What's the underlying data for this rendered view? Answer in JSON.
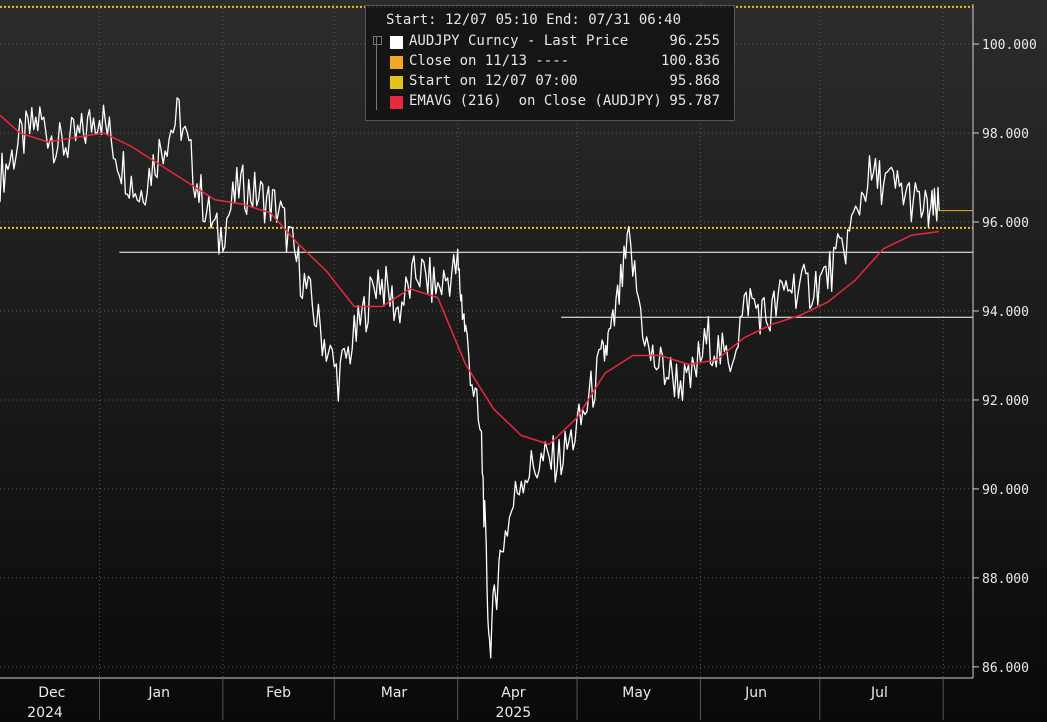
{
  "legend": {
    "header": "Start: 12/07 05:10 End: 07/31 06:40",
    "items": [
      {
        "label": "AUDJPY Curncy - Last Price",
        "value": "96.255",
        "color": "#ffffff"
      },
      {
        "label": "Close on 11/13 ----",
        "value": "100.836",
        "color": "#f5a623"
      },
      {
        "label": "Start on 12/07 07:00",
        "value": "95.868",
        "color": "#e3c21b"
      },
      {
        "label": "EMAVG (216)  on Close (AUDJPY)",
        "value": "95.787",
        "color": "#e8283c"
      }
    ]
  },
  "chart_data": {
    "type": "line",
    "y_axis_position": "right",
    "ylim": [
      85.75,
      100.9
    ],
    "yticks": [
      86.0,
      88.0,
      90.0,
      92.0,
      94.0,
      96.0,
      98.0,
      100.0
    ],
    "ytick_labels": [
      "86.000",
      "88.000",
      "90.000",
      "92.000",
      "94.000",
      "96.000",
      "98.000",
      "100.000"
    ],
    "x_months": [
      {
        "label": "Dec",
        "year": "2024"
      },
      {
        "label": "Jan",
        "year": ""
      },
      {
        "label": "Feb",
        "year": ""
      },
      {
        "label": "Mar",
        "year": ""
      },
      {
        "label": "Apr",
        "year": "2025"
      },
      {
        "label": "May",
        "year": ""
      },
      {
        "label": "Jun",
        "year": ""
      },
      {
        "label": "Jul",
        "year": ""
      }
    ],
    "grid": true,
    "series": [
      {
        "name": "AUDJPY Curncy - Last Price",
        "color": "#ffffff",
        "x": [
          "2024-12-07",
          "2024-12-12",
          "2024-12-17",
          "2024-12-22",
          "2024-12-27",
          "2025-01-01",
          "2025-01-06",
          "2025-01-11",
          "2025-01-16",
          "2025-01-21",
          "2025-01-26",
          "2025-01-31",
          "2025-02-05",
          "2025-02-10",
          "2025-02-15",
          "2025-02-20",
          "2025-02-25",
          "2025-03-02",
          "2025-03-07",
          "2025-03-12",
          "2025-03-17",
          "2025-03-22",
          "2025-03-27",
          "2025-04-01",
          "2025-04-03",
          "2025-04-07",
          "2025-04-09",
          "2025-04-12",
          "2025-04-17",
          "2025-04-22",
          "2025-04-27",
          "2025-05-02",
          "2025-05-07",
          "2025-05-10",
          "2025-05-14",
          "2025-05-19",
          "2025-05-24",
          "2025-05-29",
          "2025-06-03",
          "2025-06-08",
          "2025-06-13",
          "2025-06-18",
          "2025-06-23",
          "2025-06-28",
          "2025-07-03",
          "2025-07-08",
          "2025-07-13",
          "2025-07-18",
          "2025-07-23",
          "2025-07-28",
          "2025-07-31"
        ],
        "y": [
          97.0,
          97.8,
          98.3,
          97.7,
          97.9,
          98.5,
          97.4,
          96.6,
          97.6,
          98.4,
          96.7,
          95.6,
          96.8,
          96.6,
          96.3,
          95.0,
          93.7,
          92.5,
          93.6,
          94.8,
          94.0,
          94.9,
          94.5,
          95.0,
          93.5,
          91.0,
          86.5,
          88.7,
          90.3,
          90.6,
          90.7,
          91.5,
          92.8,
          93.6,
          95.5,
          93.0,
          92.6,
          92.3,
          93.4,
          92.8,
          94.3,
          93.8,
          94.6,
          94.5,
          94.8,
          95.6,
          97.0,
          96.9,
          96.6,
          96.2,
          96.255
        ]
      },
      {
        "name": "EMAVG (216)  on Close (AUDJPY)",
        "color": "#e8283c",
        "x": [
          "2024-12-07",
          "2024-12-12",
          "2024-12-19",
          "2024-12-26",
          "2025-01-02",
          "2025-01-09",
          "2025-01-16",
          "2025-01-23",
          "2025-01-30",
          "2025-02-06",
          "2025-02-13",
          "2025-02-20",
          "2025-02-27",
          "2025-03-06",
          "2025-03-13",
          "2025-03-20",
          "2025-03-27",
          "2025-04-03",
          "2025-04-10",
          "2025-04-17",
          "2025-04-24",
          "2025-05-01",
          "2025-05-08",
          "2025-05-15",
          "2025-05-22",
          "2025-05-29",
          "2025-06-05",
          "2025-06-12",
          "2025-06-19",
          "2025-06-26",
          "2025-07-03",
          "2025-07-10",
          "2025-07-17",
          "2025-07-24",
          "2025-07-31"
        ],
        "y": [
          98.4,
          98.0,
          97.8,
          97.9,
          98.0,
          97.7,
          97.3,
          96.9,
          96.5,
          96.4,
          96.2,
          95.5,
          94.9,
          94.1,
          94.1,
          94.5,
          94.3,
          92.8,
          91.8,
          91.2,
          91.0,
          91.6,
          92.6,
          93.0,
          93.0,
          92.8,
          92.9,
          93.4,
          93.7,
          93.9,
          94.2,
          94.7,
          95.4,
          95.7,
          95.787
        ]
      }
    ],
    "reference_lines": [
      {
        "name": "Start on 12/07 07:00",
        "value": 95.868,
        "color": "#e3c21b",
        "style": "dotted"
      },
      {
        "name": "support-line-high",
        "value": 95.32,
        "x_start": "2025-01-06",
        "color": "#ffffff",
        "style": "solid"
      },
      {
        "name": "support-line-low",
        "value": 93.86,
        "x_start": "2025-04-27",
        "color": "#ffffff",
        "style": "solid"
      },
      {
        "name": "last-price-marker",
        "value": 96.255,
        "x_start": "2025-07-31",
        "color": "#f5a623",
        "style": "solid"
      },
      {
        "name": "upper-dotted",
        "value": 100.836,
        "color": "#e3c21b",
        "style": "dotted"
      }
    ]
  }
}
